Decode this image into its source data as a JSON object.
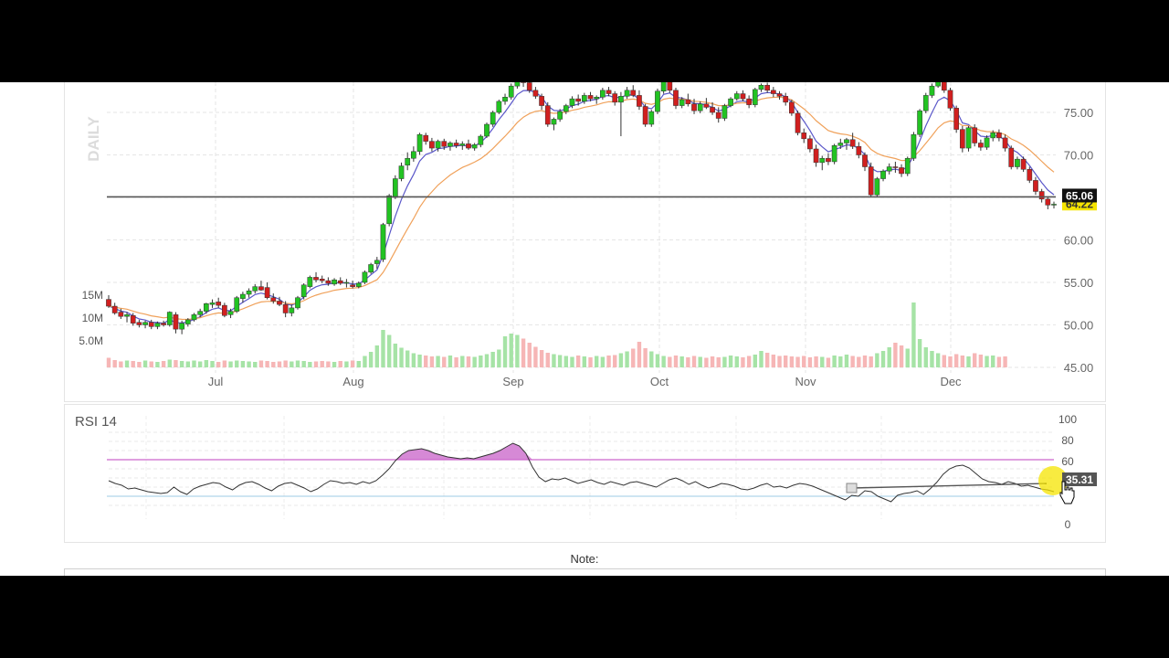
{
  "note": {
    "label": "Note:"
  },
  "chart_data": [
    {
      "type": "candlestick",
      "timeframe_label": "DAILY",
      "y_ticks": [
        75.0,
        70.0,
        65.0,
        60.0,
        55.0,
        50.0,
        45.0
      ],
      "y_tick_labels": [
        "75.00",
        "70.00",
        "65.00",
        "60.00",
        "55.00",
        "50.00",
        "45.00"
      ],
      "ylim": [
        44.5,
        79.5
      ],
      "x_tick_labels": [
        "Jul",
        "Aug",
        "Sep",
        "Oct",
        "Nov",
        "Dec"
      ],
      "horizontal_line": {
        "value": 65.06,
        "label": "65.06"
      },
      "last_price": {
        "value": 64.22,
        "label": "64.22"
      },
      "moving_averages": [
        {
          "color": "#5a57c9"
        },
        {
          "color": "#f0a15a"
        }
      ],
      "volume": {
        "y_tick_labels": [
          "15M",
          "10M",
          "5.0M"
        ],
        "up_color": "#a6e3a6",
        "down_color": "#f6b6b6"
      },
      "up_color": "#22c322",
      "down_color": "#d11f1f",
      "candles": [
        [
          53.0,
          53.5,
          52.0,
          52.2
        ],
        [
          52.2,
          52.6,
          51.2,
          51.4
        ],
        [
          51.5,
          51.9,
          50.7,
          51.0
        ],
        [
          51.0,
          51.5,
          50.3,
          51.2
        ],
        [
          51.1,
          51.4,
          49.9,
          50.2
        ],
        [
          50.3,
          50.6,
          49.7,
          50.0
        ],
        [
          50.0,
          50.5,
          49.6,
          50.3
        ],
        [
          50.3,
          50.6,
          49.5,
          49.8
        ],
        [
          49.8,
          50.4,
          49.5,
          50.2
        ],
        [
          50.2,
          50.5,
          49.8,
          50.0
        ],
        [
          50.0,
          51.6,
          49.8,
          51.5
        ],
        [
          51.2,
          51.5,
          49.0,
          49.5
        ],
        [
          49.5,
          50.5,
          48.9,
          50.2
        ],
        [
          50.1,
          50.8,
          49.8,
          50.6
        ],
        [
          50.6,
          51.4,
          50.4,
          51.2
        ],
        [
          51.2,
          51.9,
          50.9,
          51.6
        ],
        [
          51.6,
          52.6,
          51.3,
          52.5
        ],
        [
          52.4,
          53.0,
          52.0,
          52.6
        ],
        [
          52.7,
          53.2,
          52.0,
          52.3
        ],
        [
          52.3,
          52.6,
          50.9,
          51.1
        ],
        [
          51.2,
          51.9,
          50.8,
          51.6
        ],
        [
          51.6,
          53.4,
          51.4,
          53.2
        ],
        [
          53.1,
          53.9,
          52.6,
          53.6
        ],
        [
          53.6,
          54.3,
          53.2,
          54.0
        ],
        [
          54.0,
          54.8,
          53.7,
          54.5
        ],
        [
          54.5,
          55.2,
          54.0,
          54.1
        ],
        [
          54.4,
          55.0,
          53.0,
          53.2
        ],
        [
          53.2,
          53.7,
          52.5,
          52.8
        ],
        [
          52.8,
          53.3,
          52.2,
          52.4
        ],
        [
          52.4,
          52.8,
          50.9,
          51.4
        ],
        [
          51.4,
          52.4,
          51.0,
          52.0
        ],
        [
          52.0,
          53.4,
          51.8,
          53.2
        ],
        [
          53.3,
          54.9,
          53.0,
          54.7
        ],
        [
          54.5,
          55.8,
          54.3,
          55.6
        ],
        [
          55.6,
          56.2,
          55.0,
          55.3
        ],
        [
          55.4,
          55.8,
          54.9,
          55.2
        ],
        [
          55.2,
          55.6,
          54.6,
          54.9
        ],
        [
          54.8,
          55.5,
          54.6,
          55.3
        ],
        [
          55.2,
          55.6,
          54.7,
          54.9
        ],
        [
          54.9,
          55.4,
          54.4,
          55.0
        ],
        [
          54.7,
          55.2,
          54.3,
          54.5
        ],
        [
          54.5,
          55.1,
          54.3,
          54.9
        ],
        [
          55.0,
          56.4,
          54.8,
          56.2
        ],
        [
          56.2,
          57.3,
          56.0,
          57.1
        ],
        [
          57.2,
          58.0,
          56.6,
          57.6
        ],
        [
          57.7,
          62.0,
          57.4,
          61.8
        ],
        [
          61.9,
          65.4,
          61.6,
          65.2
        ],
        [
          65.0,
          67.6,
          64.8,
          67.2
        ],
        [
          67.2,
          69.1,
          66.9,
          68.7
        ],
        [
          68.8,
          70.3,
          68.2,
          69.6
        ],
        [
          69.6,
          71.0,
          69.2,
          70.4
        ],
        [
          70.4,
          72.6,
          70.0,
          72.4
        ],
        [
          72.3,
          72.6,
          71.2,
          71.6
        ],
        [
          71.6,
          72.0,
          70.4,
          70.8
        ],
        [
          70.8,
          71.8,
          70.4,
          71.6
        ],
        [
          71.6,
          71.9,
          70.6,
          71.0
        ],
        [
          71.0,
          71.6,
          70.5,
          71.4
        ],
        [
          71.4,
          71.8,
          70.8,
          71.1
        ],
        [
          71.1,
          71.6,
          70.6,
          71.3
        ],
        [
          71.3,
          71.8,
          70.6,
          70.8
        ],
        [
          70.8,
          71.4,
          70.5,
          71.2
        ],
        [
          71.2,
          72.4,
          70.9,
          72.2
        ],
        [
          72.2,
          73.8,
          72.0,
          73.6
        ],
        [
          73.6,
          75.2,
          73.3,
          75.0
        ],
        [
          75.0,
          76.5,
          74.8,
          76.3
        ],
        [
          76.3,
          77.2,
          75.9,
          76.8
        ],
        [
          76.8,
          78.4,
          76.5,
          78.1
        ],
        [
          78.1,
          79.4,
          77.8,
          79.2
        ],
        [
          79.2,
          79.6,
          78.0,
          78.5
        ],
        [
          78.5,
          78.8,
          77.3,
          77.6
        ],
        [
          77.6,
          78.0,
          76.6,
          76.9
        ],
        [
          76.9,
          77.2,
          75.3,
          75.8
        ],
        [
          75.8,
          76.2,
          73.3,
          73.6
        ],
        [
          73.6,
          74.4,
          72.9,
          74.2
        ],
        [
          74.2,
          75.4,
          73.9,
          75.1
        ],
        [
          75.1,
          76.0,
          74.8,
          75.8
        ],
        [
          75.8,
          76.9,
          75.5,
          76.6
        ],
        [
          76.6,
          77.1,
          75.8,
          76.3
        ],
        [
          76.3,
          77.3,
          76.0,
          77.0
        ],
        [
          77.0,
          77.4,
          76.3,
          76.6
        ],
        [
          76.6,
          77.0,
          76.0,
          76.8
        ],
        [
          76.8,
          77.9,
          76.5,
          77.6
        ],
        [
          77.6,
          78.0,
          76.9,
          77.2
        ],
        [
          77.2,
          77.5,
          75.8,
          76.2
        ],
        [
          76.2,
          77.4,
          72.2,
          76.9
        ],
        [
          76.9,
          78.0,
          76.6,
          77.6
        ],
        [
          77.6,
          78.2,
          76.8,
          77.0
        ],
        [
          77.0,
          77.6,
          75.3,
          75.7
        ],
        [
          75.7,
          76.0,
          73.3,
          73.6
        ],
        [
          73.6,
          75.3,
          73.3,
          75.1
        ],
        [
          75.1,
          77.8,
          74.8,
          77.5
        ],
        [
          77.5,
          79.3,
          77.2,
          79.1
        ],
        [
          79.1,
          79.5,
          77.3,
          77.6
        ],
        [
          77.6,
          77.9,
          75.4,
          75.8
        ],
        [
          75.8,
          76.8,
          75.5,
          76.5
        ],
        [
          76.5,
          77.2,
          75.7,
          76.0
        ],
        [
          76.0,
          76.6,
          74.8,
          75.2
        ],
        [
          75.2,
          76.3,
          74.9,
          76.0
        ],
        [
          76.0,
          76.7,
          75.4,
          75.6
        ],
        [
          75.6,
          76.2,
          74.7,
          75.0
        ],
        [
          75.0,
          75.6,
          73.8,
          74.3
        ],
        [
          74.3,
          76.0,
          74.0,
          75.8
        ],
        [
          75.8,
          76.8,
          75.6,
          76.6
        ],
        [
          76.6,
          77.5,
          76.4,
          77.2
        ],
        [
          77.2,
          77.6,
          76.3,
          76.6
        ],
        [
          76.6,
          77.0,
          75.5,
          75.9
        ],
        [
          75.9,
          77.9,
          75.6,
          77.7
        ],
        [
          77.7,
          78.4,
          77.4,
          78.2
        ],
        [
          78.2,
          78.5,
          77.3,
          77.6
        ],
        [
          77.6,
          78.0,
          76.8,
          77.2
        ],
        [
          77.2,
          77.5,
          76.5,
          76.9
        ],
        [
          76.9,
          77.3,
          75.8,
          76.2
        ],
        [
          76.2,
          76.5,
          74.6,
          74.9
        ],
        [
          74.9,
          75.2,
          72.3,
          72.6
        ],
        [
          72.6,
          73.1,
          71.4,
          71.9
        ],
        [
          71.9,
          72.3,
          70.3,
          70.7
        ],
        [
          70.7,
          71.2,
          68.6,
          69.1
        ],
        [
          69.1,
          69.9,
          68.2,
          69.6
        ],
        [
          69.6,
          70.2,
          68.8,
          69.2
        ],
        [
          69.2,
          71.3,
          68.9,
          71.1
        ],
        [
          71.1,
          71.9,
          70.7,
          71.4
        ],
        [
          71.4,
          72.0,
          70.6,
          71.8
        ],
        [
          71.8,
          72.6,
          70.7,
          71.0
        ],
        [
          71.0,
          71.5,
          69.6,
          70.0
        ],
        [
          70.0,
          70.3,
          68.1,
          68.6
        ],
        [
          68.6,
          69.1,
          65.0,
          65.3
        ],
        [
          65.3,
          67.4,
          65.0,
          67.2
        ],
        [
          67.2,
          68.3,
          66.9,
          68.1
        ],
        [
          68.1,
          69.0,
          67.7,
          68.6
        ],
        [
          68.6,
          69.2,
          67.9,
          68.5
        ],
        [
          68.5,
          68.9,
          67.4,
          67.8
        ],
        [
          67.8,
          69.8,
          67.5,
          69.6
        ],
        [
          69.6,
          72.7,
          69.3,
          72.4
        ],
        [
          72.4,
          75.4,
          72.1,
          75.2
        ],
        [
          75.2,
          77.3,
          74.9,
          77.0
        ],
        [
          77.0,
          78.4,
          76.7,
          78.1
        ],
        [
          78.1,
          79.4,
          77.9,
          79.2
        ],
        [
          79.2,
          79.5,
          77.3,
          77.6
        ],
        [
          77.6,
          77.9,
          75.2,
          75.5
        ],
        [
          75.5,
          75.8,
          72.6,
          73.0
        ],
        [
          73.0,
          73.4,
          70.3,
          70.8
        ],
        [
          70.8,
          73.4,
          70.4,
          73.2
        ],
        [
          73.2,
          73.6,
          71.0,
          71.4
        ],
        [
          71.4,
          71.8,
          70.5,
          70.9
        ],
        [
          70.9,
          72.3,
          70.6,
          72.0
        ],
        [
          72.0,
          72.9,
          71.6,
          72.6
        ],
        [
          72.6,
          73.0,
          71.6,
          72.0
        ],
        [
          72.0,
          72.4,
          70.4,
          70.8
        ],
        [
          70.8,
          71.1,
          68.3,
          68.6
        ],
        [
          68.6,
          69.8,
          68.3,
          69.5
        ],
        [
          69.5,
          69.8,
          68.0,
          68.3
        ],
        [
          68.3,
          68.6,
          66.7,
          67.0
        ],
        [
          67.0,
          67.4,
          65.3,
          65.7
        ],
        [
          65.7,
          66.0,
          64.4,
          64.8
        ],
        [
          64.8,
          65.1,
          63.6,
          64.1
        ],
        [
          64.1,
          64.5,
          63.7,
          64.2
        ]
      ],
      "volumes": [
        2.1,
        1.6,
        1.3,
        1.5,
        1.4,
        1.2,
        1.5,
        1.3,
        1.2,
        1.4,
        1.7,
        1.6,
        1.4,
        1.3,
        1.5,
        1.3,
        1.6,
        1.4,
        1.2,
        1.5,
        1.3,
        1.5,
        1.4,
        1.3,
        1.2,
        1.5,
        1.4,
        1.2,
        1.3,
        1.5,
        1.3,
        1.5,
        1.4,
        1.2,
        1.3,
        1.4,
        1.3,
        1.2,
        1.4,
        1.3,
        1.5,
        1.4,
        2.5,
        3.4,
        4.8,
        8.2,
        7.1,
        5.2,
        4.3,
        3.7,
        3.1,
        2.8,
        2.6,
        2.4,
        2.5,
        2.3,
        2.6,
        2.2,
        2.5,
        2.4,
        2.3,
        2.6,
        2.9,
        3.4,
        3.9,
        6.8,
        7.4,
        7.1,
        6.3,
        5.4,
        4.5,
        3.8,
        3.2,
        2.9,
        2.7,
        2.5,
        2.3,
        2.6,
        2.4,
        2.2,
        2.5,
        2.3,
        2.6,
        2.7,
        3.1,
        3.5,
        4.1,
        5.6,
        4.2,
        3.5,
        2.9,
        2.5,
        2.3,
        2.6,
        2.4,
        2.2,
        2.5,
        2.3,
        2.1,
        2.4,
        2.2,
        2.3,
        2.6,
        2.4,
        2.2,
        2.5,
        2.8,
        3.6,
        3.2,
        2.8,
        2.5,
        2.6,
        2.4,
        2.3,
        2.5,
        2.2,
        2.4,
        2.3,
        2.1,
        2.6,
        2.4,
        2.8,
        2.5,
        2.3,
        2.6,
        2.4,
        3.1,
        3.6,
        4.4,
        5.4,
        4.8,
        4.1,
        14.2,
        6.2,
        4.4,
        3.6,
        3.1,
        2.7,
        2.4,
        2.9,
        2.6,
        2.4,
        3.1,
        2.8,
        2.5,
        2.6,
        2.3,
        2.4
      ]
    },
    {
      "type": "line",
      "title": "RSI 14",
      "y_ticks": [
        100,
        80,
        60,
        40,
        0
      ],
      "y_tick_labels": [
        "100",
        "80",
        "60",
        "40",
        "0"
      ],
      "ylim": [
        0,
        100
      ],
      "overbought": 70,
      "oversold": 30,
      "current": {
        "value": 35.31,
        "label": "35.31"
      },
      "line_color": "#333333",
      "band_color": "#cc66cc",
      "fill_color": "#d689d6",
      "values": [
        47,
        44,
        42,
        38,
        39,
        37,
        35,
        34,
        33,
        34,
        40,
        35,
        32,
        38,
        41,
        43,
        45,
        44,
        40,
        37,
        42,
        45,
        46,
        43,
        39,
        36,
        41,
        44,
        45,
        42,
        39,
        35,
        38,
        43,
        47,
        46,
        44,
        45,
        43,
        46,
        44,
        47,
        53,
        60,
        69,
        76,
        80,
        81,
        82,
        80,
        77,
        75,
        73,
        72,
        71,
        72,
        71,
        73,
        75,
        77,
        80,
        84,
        88,
        85,
        77,
        62,
        51,
        46,
        49,
        48,
        50,
        47,
        44,
        46,
        48,
        45,
        43,
        46,
        44,
        42,
        45,
        46,
        44,
        42,
        40,
        44,
        48,
        50,
        47,
        43,
        46,
        42,
        39,
        41,
        44,
        43,
        41,
        38,
        37,
        39,
        42,
        44,
        40,
        41,
        39,
        42,
        44,
        43,
        41,
        38,
        35,
        32,
        29,
        26,
        31,
        30,
        36,
        35,
        30,
        27,
        24,
        31,
        33,
        34,
        36,
        32,
        38,
        45,
        54,
        60,
        63,
        64,
        61,
        55,
        49,
        46,
        45,
        43,
        46,
        44,
        41,
        42,
        40,
        38,
        37,
        35
      ]
    }
  ]
}
